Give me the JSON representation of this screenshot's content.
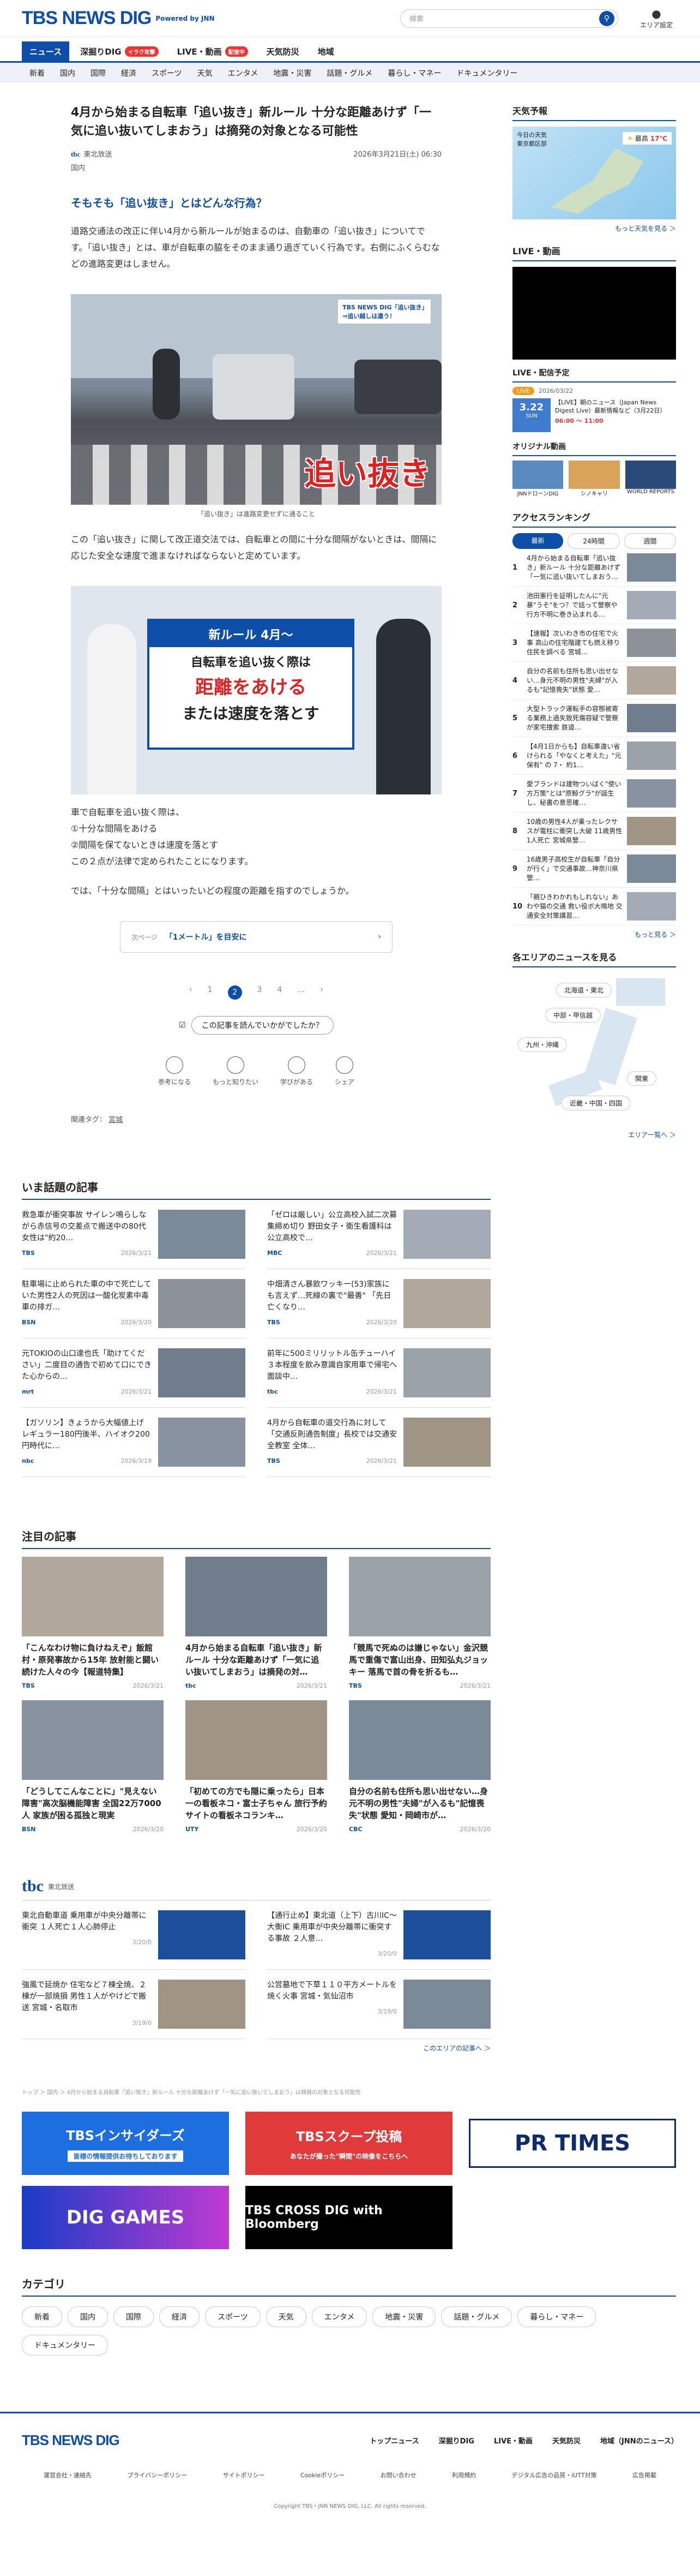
{
  "header": {
    "logo": "TBS NEWS DIG",
    "logo_sub": "Powered by JNN",
    "search_placeholder": "検索",
    "area_label": "エリア設定"
  },
  "nav_primary": [
    {
      "label": "ニュース",
      "active": true
    },
    {
      "label": "深掘りDIG",
      "badge": "イラク攻撃"
    },
    {
      "label": "LIVE・動画",
      "badge": "配信中"
    },
    {
      "label": "天気防災"
    },
    {
      "label": "地域"
    }
  ],
  "nav_secondary": [
    "新着",
    "国内",
    "国際",
    "経済",
    "スポーツ",
    "天気",
    "エンタメ",
    "地震・災害",
    "話題・グルメ",
    "暮らし・マネー",
    "ドキュメンタリー"
  ],
  "article": {
    "title": "4月から始まる自転車「追い抜き」新ルール 十分な距離あけず「一気に追い抜いてしまおう」は摘発の対象となる可能性",
    "source": "東北放送",
    "source_logo": "tbc",
    "datetime": "2026年3月21日(土) 06:30",
    "category": "国内",
    "subheading": "そもそも「追い抜き」とはどんな行為？",
    "para1": "道路交通法の改正に伴い4月から新ルールが始まるのは、自動車の「追い抜き」についてです。「追い抜き」とは、車が自転車の脇をそのまま通り過ぎていく行為です。右側にふくらむなどの進路変更はしません。",
    "img1_overlay": "追い抜き",
    "img1_wm": "TBS NEWS DIG「追い抜き」⇒追い越しは違う！",
    "img1_caption": "「追い抜き」は進路変更せずに通ること",
    "para2": "この「追い抜き」に関して改正道交法では、自転車との間に十分な間隔がないときは、間隔に応じた安全な速度で進まなければならないと定めています。",
    "img2_top": "新ルール 4月〜",
    "img2_l1": "自転車を追い抜く際は",
    "img2_l2": "距離をあける",
    "img2_l3": "または速度を落とす",
    "para3": "車で自転車を追い抜く際は、\n①十分な間隔をあける\n②間隔を保てないときは速度を落とす\nこの２点が法律で定められたことになります。",
    "para4": "では、「十分な間隔」とはいったいどの程度の距離を指すのでしょうか。",
    "nextpage_label": "次ページ",
    "nextpage_text": "「1メートル」を目安に",
    "pager": [
      "1",
      "2",
      "3",
      "4",
      "…"
    ],
    "feedback_q": "この記事を読んでいかがでしたか？",
    "reactions": [
      "参考になる",
      "もっと知りたい",
      "学びがある",
      "シェア"
    ],
    "tags_label": "関連タグ：",
    "tag": "宮城"
  },
  "trending": {
    "heading": "いま話題の記事",
    "items": [
      {
        "title": "救急車が衝突事故 サイレン鳴らしながら赤信号の交差点で搬送中の80代女性は\"約20…",
        "src": "TBS",
        "date": "2026/3/21"
      },
      {
        "title": "「ゼロは厳しい」公立高校入試二次募集締め切り 野田女子・衛生看護科は公立高校で…",
        "src": "MBC",
        "date": "2026/3/21"
      },
      {
        "title": "駐車場に止められた車の中で死亡していた男性2人の死因は一酸化炭素中毒 車の排ガ…",
        "src": "BSN",
        "date": "2026/3/20"
      },
      {
        "title": "中畑清さん暴飲ワッキー(53)家族にも言えず…死線の裏で\"最善\" 「先日亡くなり…",
        "src": "TBS",
        "date": "2026/3/20"
      },
      {
        "title": "元TOKIOの山口達也氏「助けてください」二度目の通告で初めて口にできた心からの…",
        "src": "mrt",
        "date": "2026/3/21"
      },
      {
        "title": "前年に500ミリリットル缶チューハイ３本程度を飲み意識自家用車で帰宅へ 面談中…",
        "src": "tbc",
        "date": "2026/3/21"
      },
      {
        "title": "【ガソリン】きょうから大幅値上げ レギュラー180円後半、ハイオク200円時代に…",
        "src": "nbc",
        "date": "2026/3/19"
      },
      {
        "title": "4月から自転車の道交行為に対して「交通反則通告制度」長校では交通安全教室 全体…",
        "src": "TBS",
        "date": "2026/3/21"
      }
    ]
  },
  "featured": {
    "heading": "注目の記事",
    "items": [
      {
        "title": "「こんなわけ物に負けねえぞ」飯館村・原発事故から15年 放射能と闘い続けた人々の今【報道特集】",
        "src": "TBS",
        "date": "2026/3/21"
      },
      {
        "title": "4月から始まる自転車「追い抜き」新ルール 十分な距離あけず「一気に追い抜いてしまおう」は摘発の対…",
        "src": "tbc",
        "date": "2026/3/21"
      },
      {
        "title": "「競馬で死ぬのは嫌じゃない」金沢競馬で重傷で富山出身、田知弘丸ジョッキー 落馬で首の骨を折るも…",
        "src": "TBS",
        "date": "2026/3/21"
      },
      {
        "title": "「どうしてこんなことに」\"見えない障害\"高次脳機能障害 全国22万7000人 家族が困る孤独と現実",
        "src": "BSN",
        "date": "2026/3/20"
      },
      {
        "title": "「初めての方でも隠に乗ったら」日本一の看板ネコ・富士子ちゃん 旅行予約サイトの看板ネコランキ…",
        "src": "UTY",
        "date": "2026/3/20"
      },
      {
        "title": "自分の名前も住所も思い出せない…身元不明の男性\"夫婦\"が入るも\"記憶喪失\"状態 愛知・岡崎市が…",
        "src": "CBC",
        "date": "2026/3/20"
      }
    ]
  },
  "local": {
    "logo": "tbc",
    "name": "東北放送",
    "items": [
      {
        "title": "東北自動車道 乗用車が中央分離帯に衝突 １人死亡１人心肺停止",
        "date": "3/20/0"
      },
      {
        "title": "【通行止め】東北道（上下）古川IC〜大衡IC 乗用車が中央分離帯に衝突する事故 ２人意…",
        "date": "3/20/0"
      },
      {
        "title": "強風で延焼か 住宅など７棟全焼、２棟が一部焼損 男性１人がやけどで搬送 宮城・名取市",
        "date": "3/19/0"
      },
      {
        "title": "公営墓地で下草１１０平方メートルを焼く火事 宮城・気仙沼市",
        "date": "3/19/0"
      }
    ],
    "more": "このエリアの記事へ ＞"
  },
  "breadcrumb": "トップ ＞ 国内 ＞ 4月から始まる自転車「追い抜き」新ルール 十分な距離あけず「一気に追い抜いてしまおう」は摘発の対象となる可能性",
  "banners": [
    "TBSインサイダーズ",
    "TBSスクープ投稿",
    "PR TIMES",
    "DIG GAMES",
    "TBS CROSS DIG with Bloomberg"
  ],
  "banner_subs": [
    "皆様の情報提供お待ちしております",
    "あなたが撮った\"瞬間\"の映像をこちらへ"
  ],
  "categories": {
    "heading": "カテゴリ",
    "items": [
      "新着",
      "国内",
      "国際",
      "経済",
      "スポーツ",
      "天気",
      "エンタメ",
      "地震・災害",
      "話題・グルメ",
      "暮らし・マネー",
      "ドキュメンタリー"
    ]
  },
  "footer": {
    "logo": "TBS NEWS DIG",
    "nav": [
      "トップニュース",
      "深掘りDIG",
      "LIVE・動画",
      "天気防災",
      "地域（JNNのニュース）"
    ],
    "links": [
      "運営会社・連絡先",
      "プライバシーポリシー",
      "サイトポリシー",
      "Cookieポリシー",
      "お問い合わせ",
      "利用規約",
      "デジタル広告の品質・iUTT対策",
      "広告掲載"
    ],
    "copyright": "Copyright TBS・JNN NEWS DIG, LLC. All rights reserved."
  },
  "sidebar": {
    "weather_h": "天気予報",
    "weather_day": "今日の天気",
    "weather_place": "東京都区部",
    "weather_hi_label": "最高",
    "weather_hi": "17℃",
    "weather_more": "もっと天気を見る ＞",
    "live_h": "LIVE・動画",
    "live_sched_h": "LIVE・配信予定",
    "live_badge": "LIVE",
    "live_date": "2026/03/22",
    "live_title": "【LIVE】朝のニュース（Japan News Digest Live）最新情報など（3月22日）",
    "live_date_box": "3.22",
    "live_dow": "SUN",
    "live_time": "06:00 〜 11:00",
    "original_h": "オリジナル動画",
    "originals": [
      "JNNドローンDIG",
      "シノキャリ",
      "WORLD REPORTS"
    ],
    "ranking_h": "アクセスランキング",
    "ranking_tabs": [
      "最新",
      "24時間",
      "週間"
    ],
    "ranking": [
      "4月から始まる自転車「追い抜き」新ルール 十分な距離あけず「一気に追い抜いてしまおう…",
      "池田憲行を証明したんに\"元暴\"うそ\"をつ？で話って警察や行方不明に巻き込まれる…",
      "【速報】次いわき市の住宅で火事 高山の住宅階建ても燃え移り住民を調べる 宮城…",
      "自分の名前も住所も思い出せない…身元不明の男性\"夫婦\"が入るも\"記憶喪失\"状態 愛…",
      "大型トラック運転手の容態被寄る業務上過失致死傷容疑で警察が家宅捜索 鉄道…",
      "【4月1日からも】自転車違い省けられる「やなくと考えた」\"元保有\" の 7・ 約1…",
      "愛ブランドは建物ついばく\"使い方万策\"とは\"原鯨グラ\"が誕生し、秘書の意思確…",
      "10歳の男性4人が乗ったレクサスが電柱に衝突し大破 11歳男性1人死亡 宮城県警…",
      "16歳男子高校生が自転車「自分が行く」で交通事故…神奈川県警…",
      "「親ひきわかれもしれない」あわや猫の交通 救い役ボ大鳴地 交通安全対策講習…"
    ],
    "ranking_more": "もっと見る ＞",
    "areas_h": "各エリアのニュースを見る",
    "areas": [
      "北海道・東北",
      "中部・甲信越",
      "関東",
      "九州・沖縄",
      "近畿・中国・四国"
    ],
    "areas_more": "エリア一覧へ ＞"
  },
  "colors": {
    "brand": "#0d4fa8",
    "red": "#e33333"
  }
}
